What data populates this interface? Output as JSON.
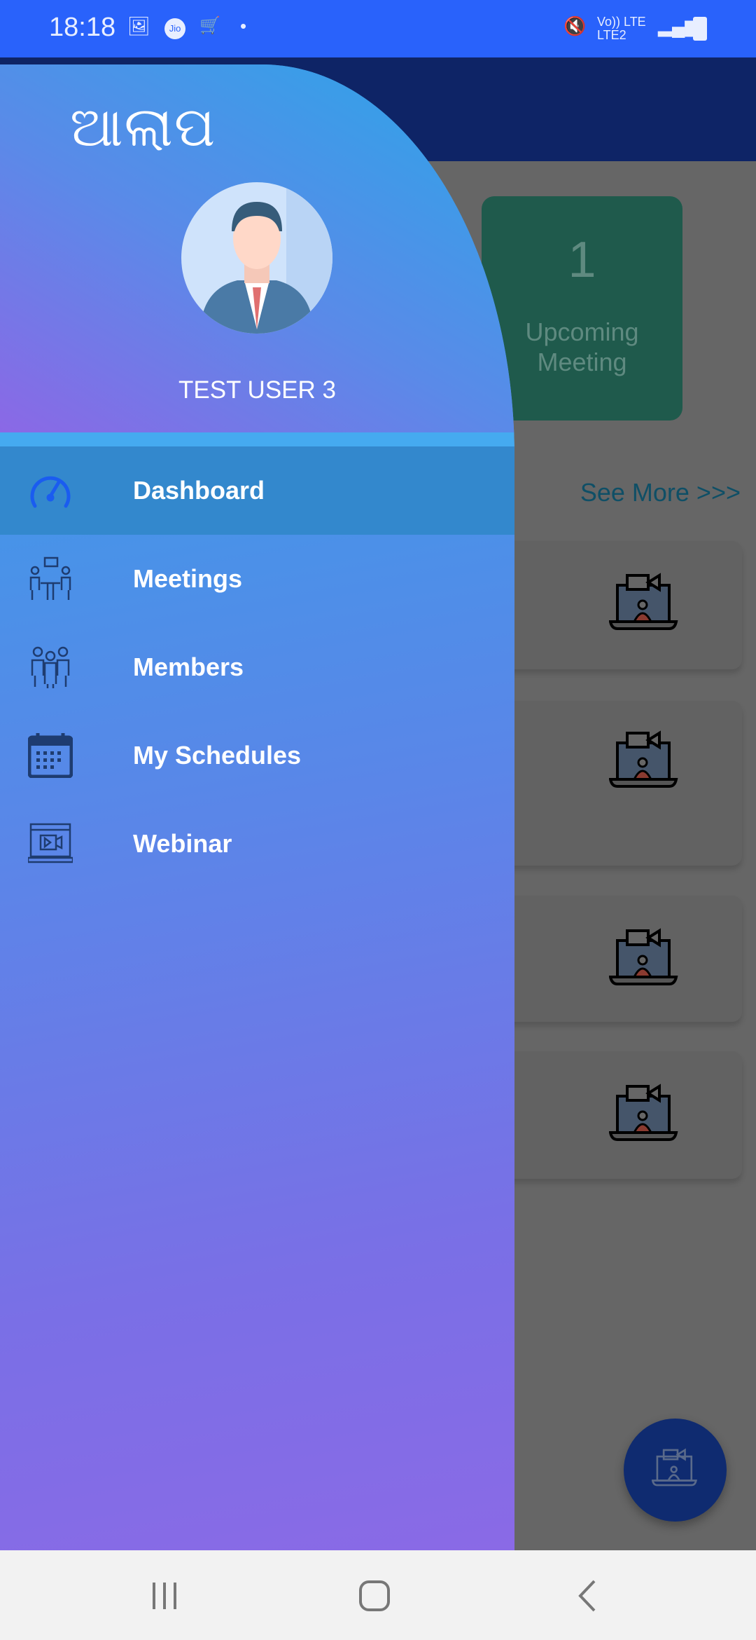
{
  "status_bar": {
    "time": "18:18",
    "network": "Vo)) LTE LTE2"
  },
  "drawer": {
    "logo_text": "ଆଲାପ",
    "user_name": "TEST USER 3",
    "items": [
      {
        "label": "Dashboard",
        "icon": "speedometer-icon",
        "active": true
      },
      {
        "label": "Meetings",
        "icon": "meeting-icon",
        "active": false
      },
      {
        "label": "Members",
        "icon": "members-icon",
        "active": false
      },
      {
        "label": "My Schedules",
        "icon": "calendar-icon",
        "active": false
      },
      {
        "label": "Webinar",
        "icon": "webinar-icon",
        "active": false
      }
    ]
  },
  "main": {
    "stat": {
      "count": "1",
      "label_line1": "Upcoming",
      "label_line2": "Meeting"
    },
    "see_more": "See More >>>"
  },
  "colors": {
    "status_bar": "#2962fb",
    "app_bar": "#0e2466",
    "stat_card": "#1f5a4c",
    "fab": "#0f2b70"
  }
}
